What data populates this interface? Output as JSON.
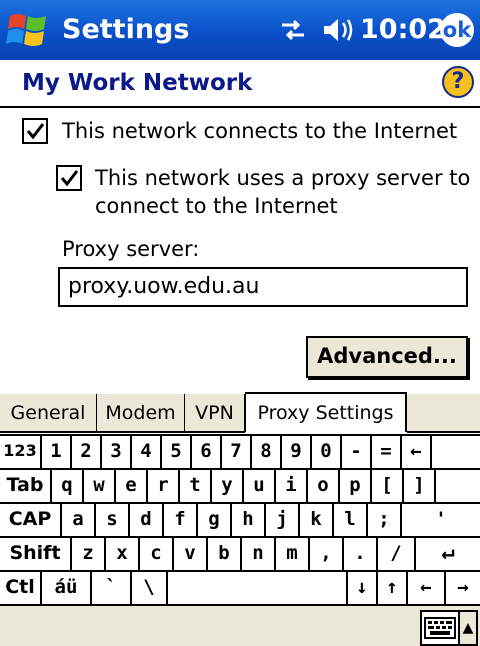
{
  "titlebar": {
    "app_title": "Settings",
    "clock": "10:02",
    "ok_label": "ok"
  },
  "header": {
    "page_title": "My Work Network",
    "help_label": "?"
  },
  "form": {
    "internet_checkbox": {
      "label": "This network connects to the Internet",
      "checked": true
    },
    "proxy_checkbox": {
      "label_line1": "This network uses a proxy server to",
      "label_line2": "connect to the Internet",
      "checked": true
    },
    "proxy_server_label": "Proxy server:",
    "proxy_server_value": "proxy.uow.edu.au",
    "advanced_button": "Advanced..."
  },
  "tabs": [
    {
      "label": "General",
      "active": false
    },
    {
      "label": "Modem",
      "active": false
    },
    {
      "label": "VPN",
      "active": false
    },
    {
      "label": "Proxy Settings",
      "active": true
    }
  ],
  "keyboard": {
    "rows": [
      [
        "123",
        "1",
        "2",
        "3",
        "4",
        "5",
        "6",
        "7",
        "8",
        "9",
        "0",
        "-",
        "=",
        "←"
      ],
      [
        "Tab",
        "q",
        "w",
        "e",
        "r",
        "t",
        "y",
        "u",
        "i",
        "o",
        "p",
        "[",
        "]"
      ],
      [
        "CAP",
        "a",
        "s",
        "d",
        "f",
        "g",
        "h",
        "j",
        "k",
        "l",
        ";",
        "'"
      ],
      [
        "Shift",
        "z",
        "x",
        "c",
        "v",
        "b",
        "n",
        "m",
        ",",
        ".",
        "/",
        "↵"
      ],
      [
        "Ctl",
        "áü",
        "`",
        "\\",
        "",
        "↓",
        "↑",
        "←",
        "→"
      ]
    ]
  },
  "bottom_bar": {
    "sip_icon": "keyboard-icon",
    "sip_arrow": "▲"
  },
  "colors": {
    "titlebar": "#0a4fc8",
    "title_text": "#0a1a88",
    "tab_bg": "#ece8d8"
  }
}
